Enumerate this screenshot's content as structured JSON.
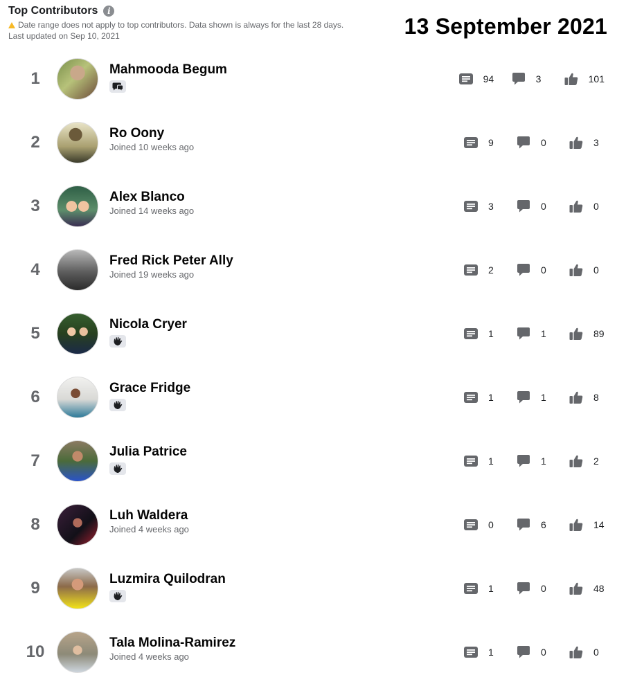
{
  "header": {
    "title": "Top Contributors",
    "notice": "Date range does not apply to top contributors. Data shown is always for the last 28 days.",
    "updated": "Last updated on Sep 10, 2021"
  },
  "date_stamp": "13 September 2021",
  "colors": {
    "icon": "#65676b",
    "warning": "#f7b928",
    "rank": "#65676b"
  },
  "contributors": [
    {
      "rank": "1",
      "name": "Mahmooda Begum",
      "sub": "",
      "badge": "conversation-starter-icon",
      "posts": "94",
      "comments": "3",
      "reactions": "101"
    },
    {
      "rank": "2",
      "name": "Ro Oony",
      "sub": "Joined 10 weeks ago",
      "badge": "",
      "posts": "9",
      "comments": "0",
      "reactions": "3"
    },
    {
      "rank": "3",
      "name": "Alex Blanco",
      "sub": "Joined 14 weeks ago",
      "badge": "",
      "posts": "3",
      "comments": "0",
      "reactions": "0"
    },
    {
      "rank": "4",
      "name": "Fred Rick Peter Ally",
      "sub": "Joined 19 weeks ago",
      "badge": "",
      "posts": "2",
      "comments": "0",
      "reactions": "0"
    },
    {
      "rank": "5",
      "name": "Nicola Cryer",
      "sub": "",
      "badge": "wave-icon",
      "posts": "1",
      "comments": "1",
      "reactions": "89"
    },
    {
      "rank": "6",
      "name": "Grace Fridge",
      "sub": "",
      "badge": "wave-icon",
      "posts": "1",
      "comments": "1",
      "reactions": "8"
    },
    {
      "rank": "7",
      "name": "Julia Patrice",
      "sub": "",
      "badge": "wave-icon",
      "posts": "1",
      "comments": "1",
      "reactions": "2"
    },
    {
      "rank": "8",
      "name": "Luh Waldera",
      "sub": "Joined 4 weeks ago",
      "badge": "",
      "posts": "0",
      "comments": "6",
      "reactions": "14"
    },
    {
      "rank": "9",
      "name": "Luzmira Quilodran",
      "sub": "",
      "badge": "wave-icon",
      "posts": "1",
      "comments": "0",
      "reactions": "48"
    },
    {
      "rank": "10",
      "name": "Tala Molina-Ramirez",
      "sub": "Joined 4 weeks ago",
      "badge": "",
      "posts": "1",
      "comments": "0",
      "reactions": "0"
    }
  ]
}
